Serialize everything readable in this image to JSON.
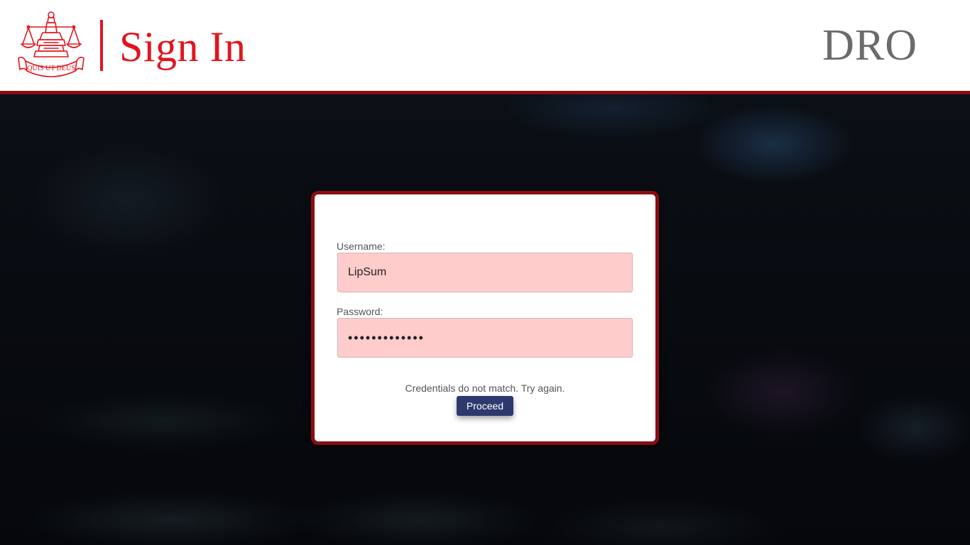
{
  "header": {
    "crest_motto": "QUIS UT DEUS",
    "title": "Sign In",
    "app_name": "DRO"
  },
  "login_form": {
    "username_label": "Username:",
    "username_value": "LipSum",
    "password_label": "Password:",
    "password_value": "•••••••••••••",
    "error_message": "Credentials do not match. Try again.",
    "proceed_label": "Proceed"
  },
  "colors": {
    "brand_red": "#e0161f",
    "dark_red": "#8b0d14",
    "input_error_bg": "#ffcccc",
    "button_navy": "#2e3a6e",
    "app_name_gray": "#6b6b6b"
  }
}
